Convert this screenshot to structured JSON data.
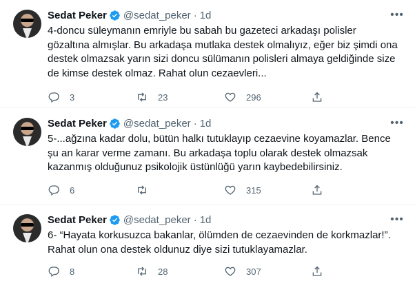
{
  "colors": {
    "text": "#0f1419",
    "muted": "#536471",
    "verified": "#1d9bf0",
    "divider": "#eff3f4"
  },
  "tweets": [
    {
      "name": "Sedat Peker",
      "handle": "@sedat_peker",
      "separator": "·",
      "time": "1d",
      "text": "4-doncu süleymanın emriyle bu sabah bu gazeteci arkadaşı polisler\ngözaltına almışlar. Bu arkadaşa mutlaka destek olmalıyız, eğer biz şimdi ona\ndestek olmazsak yarın sizi doncu sülümanın polisleri almaya geldiğinde size\nde kimse destek olmaz. Rahat olun cezaevleri...",
      "replies": "3",
      "retweets": "23",
      "likes": "296"
    },
    {
      "name": "Sedat Peker",
      "handle": "@sedat_peker",
      "separator": "·",
      "time": "1d",
      "text": "5-...ağzına kadar dolu, bütün halkı tutuklayıp cezaevine koyamazlar. Bence\nşu an karar verme zamanı. Bu arkadaşa toplu olarak destek olmazsak\nkazanmış olduğunuz psikolojik üstünlüğü yarın kaybedebilirsiniz.",
      "replies": "6",
      "retweets": "",
      "likes": "315"
    },
    {
      "name": "Sedat Peker",
      "handle": "@sedat_peker",
      "separator": "·",
      "time": "1d",
      "text": "6- “Hayata korkusuzca bakanlar, ölümden de cezaevinden de korkmazlar!”.\nRahat olun ona destek oldunuz diye sizi tutuklayamazlar.",
      "replies": "8",
      "retweets": "28",
      "likes": "307"
    }
  ],
  "icons": {
    "avatar": "avatar",
    "verified": "verified-badge-icon",
    "more": "more-icon",
    "reply": "reply-icon",
    "retweet": "retweet-icon",
    "like": "like-icon",
    "share": "share-icon"
  }
}
